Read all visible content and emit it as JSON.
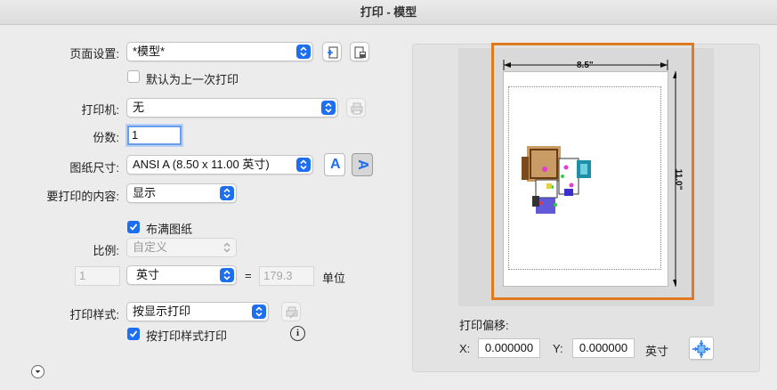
{
  "window": {
    "title": "打印 - 模型"
  },
  "page_setup": {
    "label": "页面设置:",
    "value": "*模型*",
    "checkbox_label": "默认为上一次打印",
    "checked": false
  },
  "printer": {
    "label": "打印机:",
    "value": "无"
  },
  "copies": {
    "label": "份数:",
    "value": "1"
  },
  "paper_size": {
    "label": "图纸尺寸:",
    "value": "ANSI A (8.50 x 11.00 英寸)",
    "orientation_portrait_glyph": "A",
    "orientation_landscape_glyph": "A"
  },
  "what_to_print": {
    "label": "要打印的内容:",
    "value": "显示"
  },
  "fit_to_paper": {
    "label": "布满图纸",
    "checked": true
  },
  "scale": {
    "label": "比例:",
    "value": "自定义",
    "left_value": "1",
    "unit": "英寸",
    "equals": "=",
    "right_value": "179.3",
    "units_label": "单位"
  },
  "plot_style": {
    "label": "打印样式:",
    "value": "按显示打印",
    "checkbox_label": "按打印样式打印",
    "checked": true
  },
  "preview": {
    "width_label": "8.5\"",
    "height_label": "11.0\""
  },
  "offset": {
    "title": "打印偏移:",
    "x_label": "X:",
    "x_value": "0.000000",
    "y_label": "Y:",
    "y_value": "0.000000",
    "unit": "英寸"
  },
  "colors": {
    "accent": "#1c6ef2",
    "highlight": "#e07a1f"
  }
}
